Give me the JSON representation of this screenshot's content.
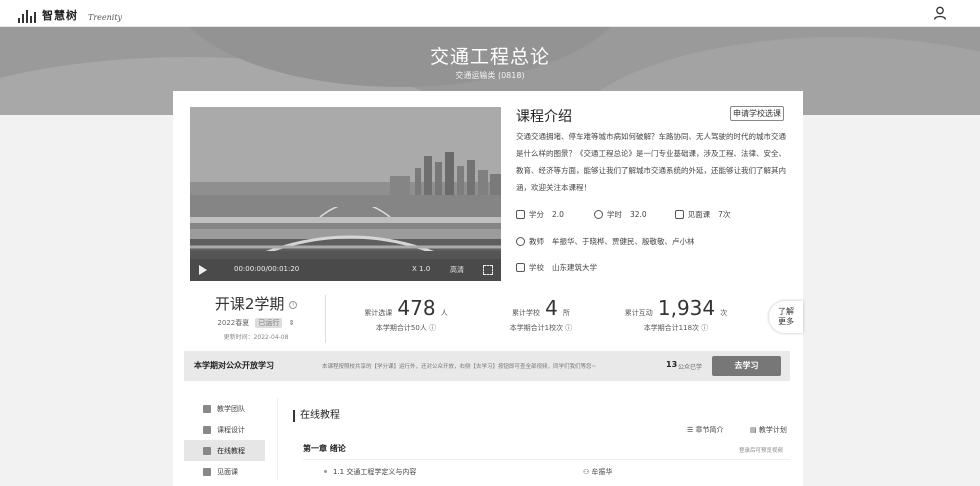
{
  "header": {
    "logo_text": "智慧树",
    "logo_sub": "Treenity"
  },
  "banner": {
    "title": "交通工程总论",
    "subtitle": "交通运输类 (0818)"
  },
  "video": {
    "time": "00:00:00/00:01:20",
    "speed": "X 1.0",
    "quality": "高清"
  },
  "intro": {
    "title": "课程介绍",
    "apply_label": "申请学校选课",
    "text": "交通交通拥堵、停车难等城市病如何破解？车路协同、无人驾驶的时代的城市交通是什么样的图景？《交通工程总论》是一门专业基础课，涉及工程、法律、安全、教育、经济等方面，能够让我们了解城市交通系统的外延，还能够让我们了解其内涵，欢迎关注本课程！",
    "credit_label": "学分",
    "credit": "2.0",
    "hours_label": "学时",
    "hours": "32.0",
    "meet_label": "见面课",
    "meet": "7次",
    "teacher_label": "教师",
    "teachers": "牟振华、于晓桦、贾健民、殷敬敬、卢小林",
    "school_label": "学校",
    "school": "山东建筑大学"
  },
  "term": {
    "title": "开课2学期",
    "season": "2022春夏",
    "status": "已运行",
    "update": "更新时间：2022-04-08"
  },
  "stats": [
    {
      "label": "累计选课",
      "value": "478",
      "unit": "人",
      "sub": "本学期合计50人"
    },
    {
      "label": "累计学校",
      "value": "4",
      "unit": "所",
      "sub": "本学期合计1校次"
    },
    {
      "label": "累计互动",
      "value": "1,934",
      "unit": "次",
      "sub": "本学期合计118次"
    }
  ],
  "more": {
    "line1": "了解",
    "line2": "更多"
  },
  "open_course": {
    "title": "本学期对公众开放学习",
    "desc": "本课程按照校共享的【学分课】运行外，还对公众开放，右侧【去学习】按钮即可查全部视频，同学们我们等您~",
    "count": "13",
    "count_label": "公众已学",
    "button": "去学习"
  },
  "sidenav": [
    {
      "label": "教学团队"
    },
    {
      "label": "课程设计"
    },
    {
      "label": "在线教程"
    },
    {
      "label": "见面课"
    }
  ],
  "tutorial": {
    "title": "在线教程",
    "chapter_intro": "章节简介",
    "study_plan": "教学计划",
    "chapter": "第一章  绪论",
    "login_hint": "登录后可预览视频",
    "lesson": "1.1  交通工程学定义与内容",
    "lesson_teacher": "牟振华"
  }
}
